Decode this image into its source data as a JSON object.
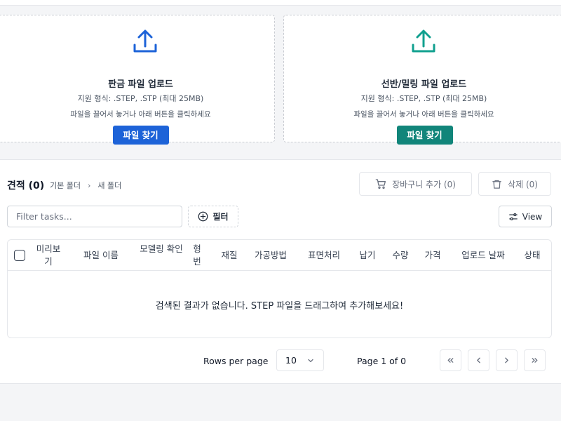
{
  "upload": {
    "sheet": {
      "title": "판금 파일 업로드",
      "format": "지원 형식: .STEP, .STP (최대 25MB)",
      "hint": "파일을 끌어서 놓거나 아래 버튼을 클릭하세요",
      "button": "파일 찾기",
      "icon": "upload-icon",
      "color": "#1d63d8"
    },
    "lathe": {
      "title": "선반/밀링 파일 업로드",
      "format": "지원 형식: .STEP, .STP (최대 25MB)",
      "hint": "파일을 끌어서 놓거나 아래 버튼을 클릭하세요",
      "button": "파일 찾기",
      "icon": "upload-icon",
      "color": "#11857a"
    }
  },
  "quotes": {
    "title": "견적 (0)",
    "breadcrumb": [
      "기본 폴더",
      "새 폴더"
    ],
    "cart_button": "장바구니 추가 (0)",
    "delete_button": "삭제 (0)"
  },
  "toolbar": {
    "filter_placeholder": "Filter tasks...",
    "filter_button": "필터",
    "view_button": "View"
  },
  "table": {
    "columns": [
      "미리보기",
      "파일 이름",
      "모델링 확인",
      "형번",
      "재질",
      "가공방법",
      "표면처리",
      "납기",
      "수량",
      "가격",
      "업로드 날짜",
      "상태"
    ],
    "empty_message": "검색된 결과가 없습니다. STEP 파일을 드래그하여 추가해보세요!"
  },
  "pagination": {
    "rows_label": "Rows per page",
    "rows_value": "10",
    "page_label": "Page 1 of 0"
  }
}
